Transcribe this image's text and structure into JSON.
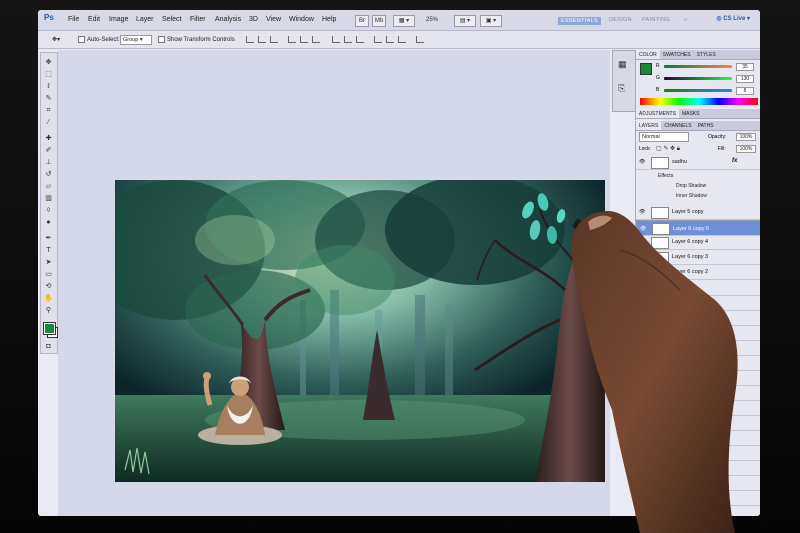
{
  "app": {
    "logo": "Ps"
  },
  "menu": [
    "File",
    "Edit",
    "Image",
    "Layer",
    "Select",
    "Filter",
    "Analysis",
    "3D",
    "View",
    "Window",
    "Help"
  ],
  "menubar_controls": {
    "mb": "Mb",
    "zoom": "25%"
  },
  "workspaces": {
    "essentials": "ESSENTIALS",
    "design": "DESIGN",
    "painting": "PAINTING"
  },
  "cs_live": "CS Live",
  "options": {
    "auto_select_label": "Auto-Select:",
    "auto_select_value": "Group",
    "show_transform_label": "Show Transform Controls"
  },
  "color_panel": {
    "tabs": [
      "COLOR",
      "SWATCHES",
      "STYLES"
    ],
    "r_label": "R",
    "g_label": "G",
    "b_label": "B",
    "r_value": "35",
    "g_value": "130",
    "b_value": "8"
  },
  "adjustments_tabs": [
    "ADJUSTMENTS",
    "MASKS"
  ],
  "layers_panel": {
    "tabs": [
      "LAYERS",
      "CHANNELS",
      "PATHS"
    ],
    "blend_mode": "Normal",
    "opacity_label": "Opacity:",
    "opacity_value": "100%",
    "lock_label": "Lock:",
    "fill_label": "Fill:",
    "fill_value": "100%",
    "layers": [
      {
        "name": "sadhu",
        "fx": "fx"
      },
      {
        "name": "Layer 5 copy"
      },
      {
        "name": "Layer 6 copy 5"
      },
      {
        "name": "Layer 6 copy 4"
      },
      {
        "name": "Layer 6 copy 3"
      },
      {
        "name": "Layer 6 copy 2"
      }
    ],
    "effects_label": "Effects",
    "effect_1": "Drop Shadow",
    "effect_2": "Inner Shadow"
  },
  "colors": {
    "accent": "#6f8fd8",
    "foreground": "#198a3a"
  }
}
